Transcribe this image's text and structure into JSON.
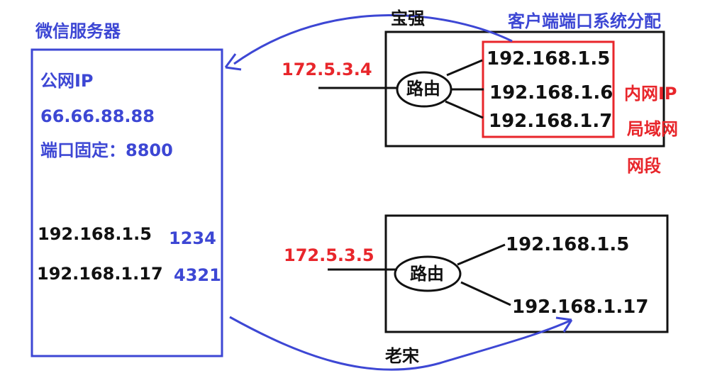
{
  "server": {
    "title": "微信服务器",
    "public_ip_label": "公网IP",
    "public_ip": "66.66.88.88",
    "port_fixed": "端口固定：8800",
    "mappings": [
      {
        "ip": "192.168.1.5",
        "port": "1234"
      },
      {
        "ip": "192.168.1.17",
        "port": "4321"
      }
    ]
  },
  "network_top": {
    "owner": "宝强",
    "client_port_note": "客户端端口系统分配",
    "public_ip": "172.5.3.4",
    "router_label": "路由",
    "hosts": [
      "192.168.1.5",
      "192.168.1.6",
      "192.168.1.7"
    ],
    "intranet_label": "内网IP",
    "lan_label": "局域网",
    "segment_label": "网段"
  },
  "network_bottom": {
    "owner": "老宋",
    "public_ip": "172.5.3.5",
    "router_label": "路由",
    "hosts": [
      "192.168.1.5",
      "192.168.1.17"
    ]
  },
  "colors": {
    "blue": "#3d47d4",
    "red": "#e8262b",
    "black": "#111111"
  }
}
